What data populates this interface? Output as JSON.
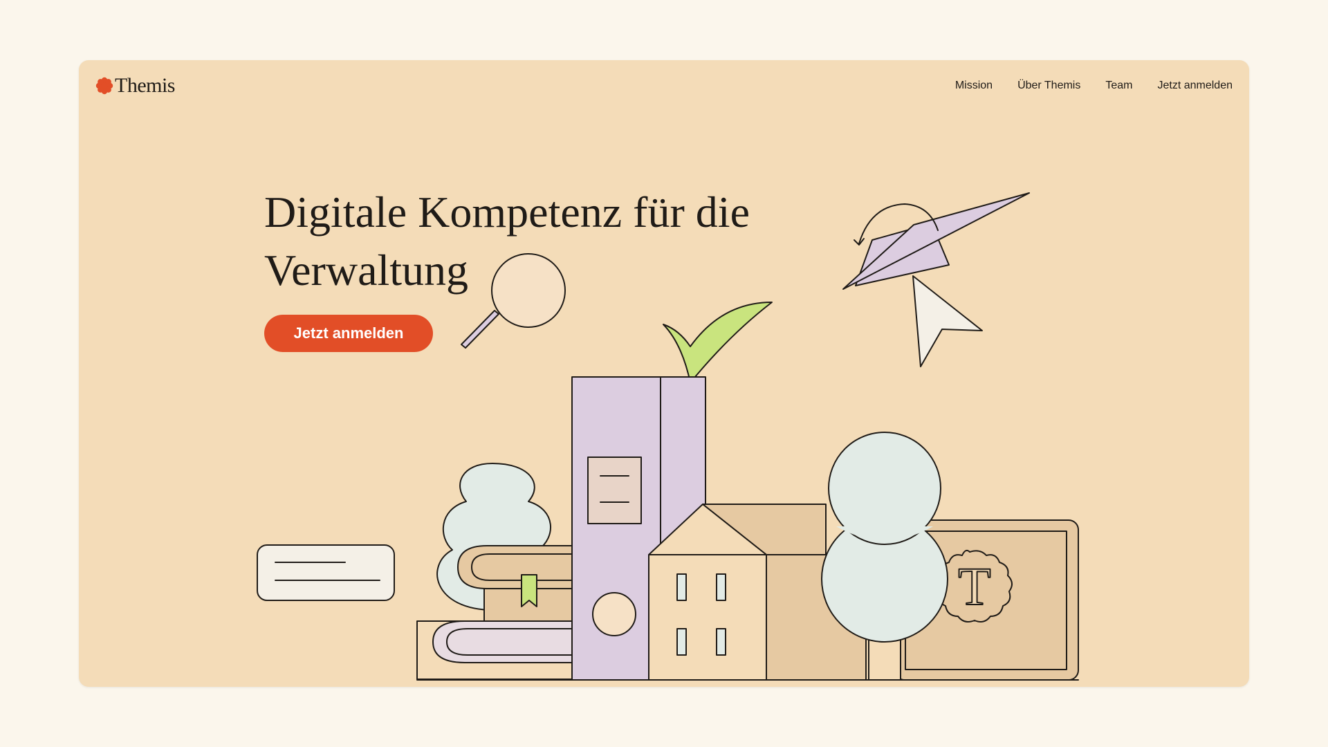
{
  "brand": {
    "name": "Themis",
    "logo_color": "#e24e27"
  },
  "nav": {
    "items": [
      {
        "label": "Mission"
      },
      {
        "label": "Über Themis"
      },
      {
        "label": "Team"
      },
      {
        "label": "Jetzt anmelden"
      }
    ]
  },
  "hero": {
    "headline": "Digitale Kompetenz für die Verwaltung",
    "cta_label": "Jetzt anmelden"
  },
  "illustration": {
    "seal_letter": "T",
    "icons": [
      "magnifier-icon",
      "graduation-cap-icon",
      "cursor-arrow-icon",
      "checkmark-icon",
      "binder-icon",
      "books-icon",
      "house-icon",
      "tree-icon",
      "certificate-icon",
      "text-box-icon"
    ]
  },
  "colors": {
    "page_bg": "#fbf6ec",
    "card_bg": "#f4dcb8",
    "accent": "#e24e27",
    "lavender": "#dccde0",
    "mint": "#e2ebe6",
    "green": "#c9e47e",
    "tan": "#e6c9a2",
    "ink": "#1f1b17"
  }
}
